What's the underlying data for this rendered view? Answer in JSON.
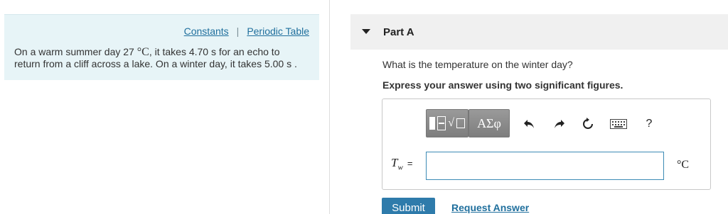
{
  "left": {
    "links": {
      "constants": "Constants",
      "separator": "|",
      "periodic_table": "Periodic Table"
    },
    "problem": {
      "text_1": "On a warm summer day 27 ",
      "temp_unit": "°C",
      "text_2": ", it takes 4.70 s for an echo to return from a cliff across a lake. On a winter day, it takes 5.00 s ."
    }
  },
  "part": {
    "title": "Part A",
    "question": "What is the temperature on the winter day?",
    "instruction": "Express your answer using two significant figures."
  },
  "toolbar": {
    "greek_label": "ΑΣφ",
    "help_label": "?",
    "icons": [
      "template-icon",
      "greek-symbols",
      "undo-icon",
      "redo-icon",
      "reset-icon",
      "keyboard-icon",
      "help-icon"
    ]
  },
  "answer": {
    "variable": "T",
    "subscript": "w",
    "equals": "=",
    "value": "",
    "unit": "°C"
  },
  "actions": {
    "submit": "Submit",
    "request_answer": "Request Answer"
  },
  "colors": {
    "accent": "#2e7bab",
    "link": "#1f6f9d",
    "info_bg": "#e7f4f7"
  }
}
